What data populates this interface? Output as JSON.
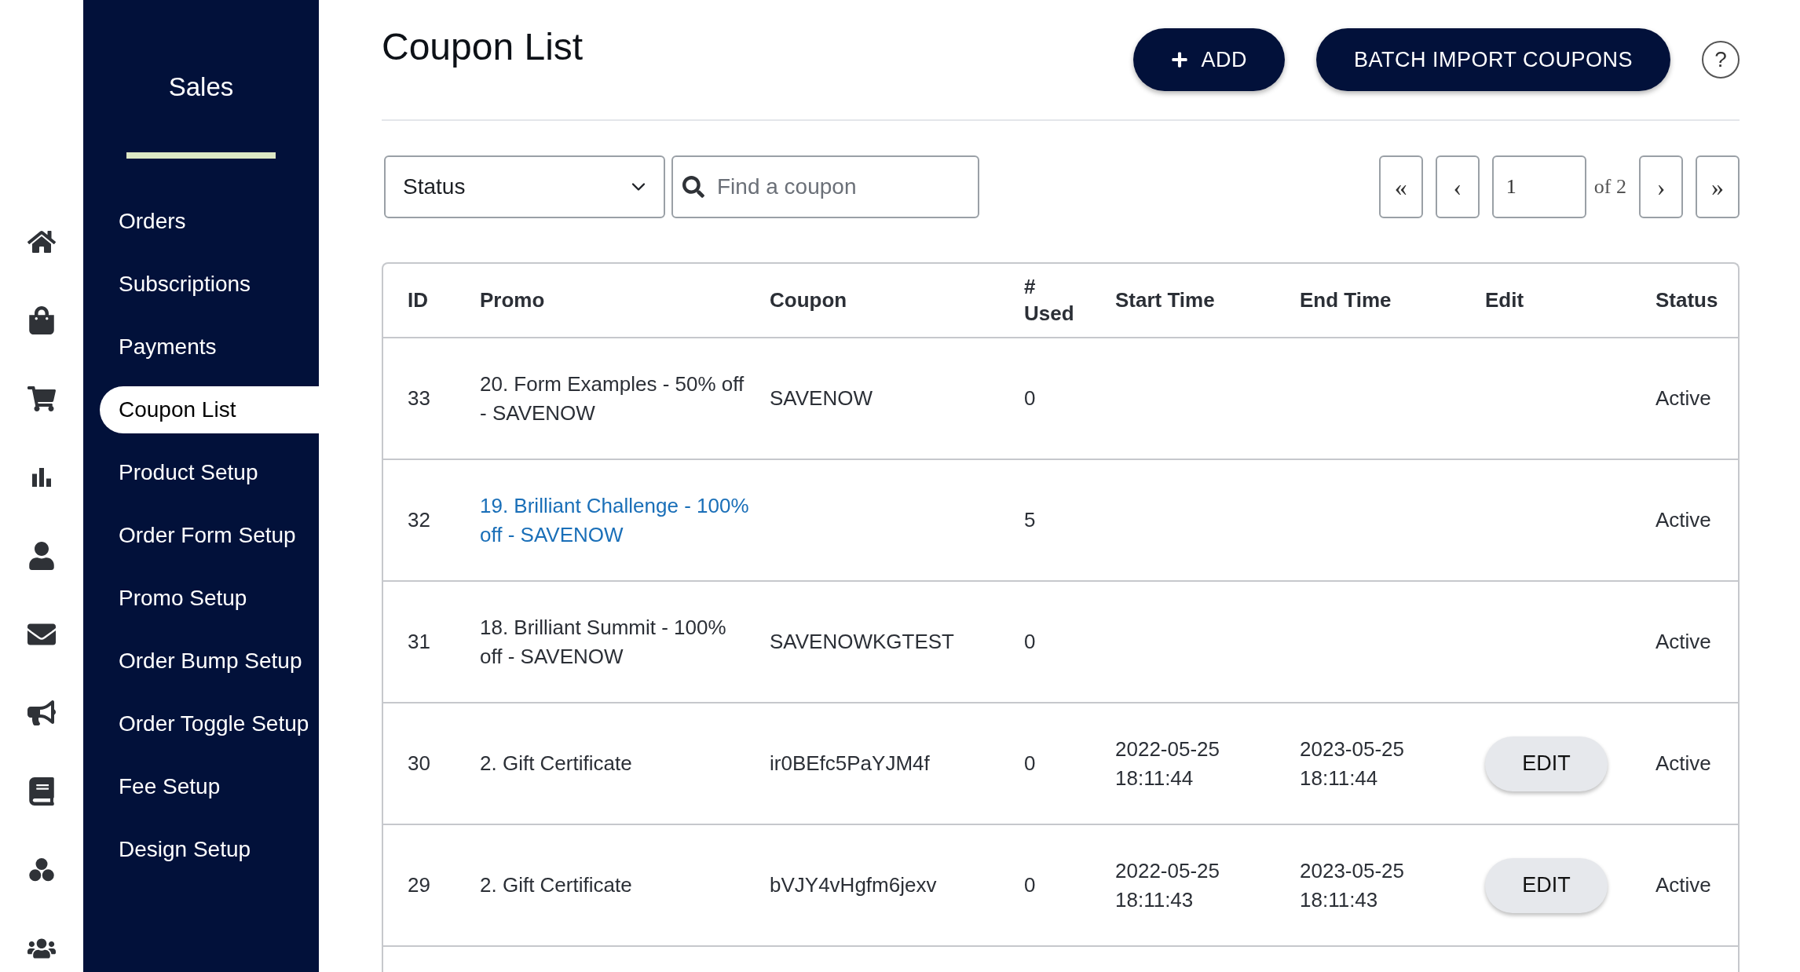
{
  "sidebar": {
    "title": "Sales",
    "items": [
      {
        "label": "Orders",
        "selected": false
      },
      {
        "label": "Subscriptions",
        "selected": false
      },
      {
        "label": "Payments",
        "selected": false
      },
      {
        "label": "Coupon List",
        "selected": true
      },
      {
        "label": "Product Setup",
        "selected": false
      },
      {
        "label": "Order Form Setup",
        "selected": false
      },
      {
        "label": "Promo Setup",
        "selected": false
      },
      {
        "label": "Order Bump Setup",
        "selected": false
      },
      {
        "label": "Order Toggle Setup",
        "selected": false
      },
      {
        "label": "Fee Setup",
        "selected": false
      },
      {
        "label": "Design Setup",
        "selected": false
      }
    ]
  },
  "header": {
    "title": "Coupon List",
    "add_button": "ADD",
    "batch_button": "BATCH IMPORT COUPONS",
    "help": "?"
  },
  "filters": {
    "status": {
      "value": "Status"
    },
    "search": {
      "placeholder": "Find a coupon"
    }
  },
  "pagination": {
    "first": "«",
    "prev": "‹",
    "page": "1",
    "of": "of 2",
    "next": "›",
    "last": "»"
  },
  "table": {
    "columns": [
      "ID",
      "Promo",
      "Coupon",
      "#\nUsed",
      "Start Time",
      "End Time",
      "Edit",
      "Status"
    ],
    "rows": [
      {
        "id": "33",
        "promo": "20. Form Examples - 50% off - SAVENOW",
        "promo_link": false,
        "coupon": "SAVENOW",
        "used": "0",
        "status": "Active"
      },
      {
        "id": "32",
        "promo": "19. Brilliant Challenge - 100% off - SAVENOW",
        "promo_link": true,
        "used": "5",
        "status": "Active"
      },
      {
        "id": "31",
        "promo": "18. Brilliant Summit - 100% off - SAVENOW",
        "promo_link": false,
        "coupon": "SAVENOWKGTEST",
        "used": "0",
        "status": "Active"
      },
      {
        "id": "30",
        "promo": "2. Gift Certificate",
        "promo_link": false,
        "coupon": "ir0BEfc5PaYJM4f",
        "used": "0",
        "start": "2022-05-25 18:11:44",
        "end": "2023-05-25 18:11:44",
        "edit": "EDIT",
        "status": "Active"
      },
      {
        "id": "29",
        "promo": "2. Gift Certificate",
        "promo_link": false,
        "coupon": "bVJY4vHgfm6jexv",
        "used": "0",
        "start": "2022-05-25 18:11:43",
        "end": "2023-05-25 18:11:43",
        "edit": "EDIT",
        "status": "Active"
      }
    ]
  }
}
